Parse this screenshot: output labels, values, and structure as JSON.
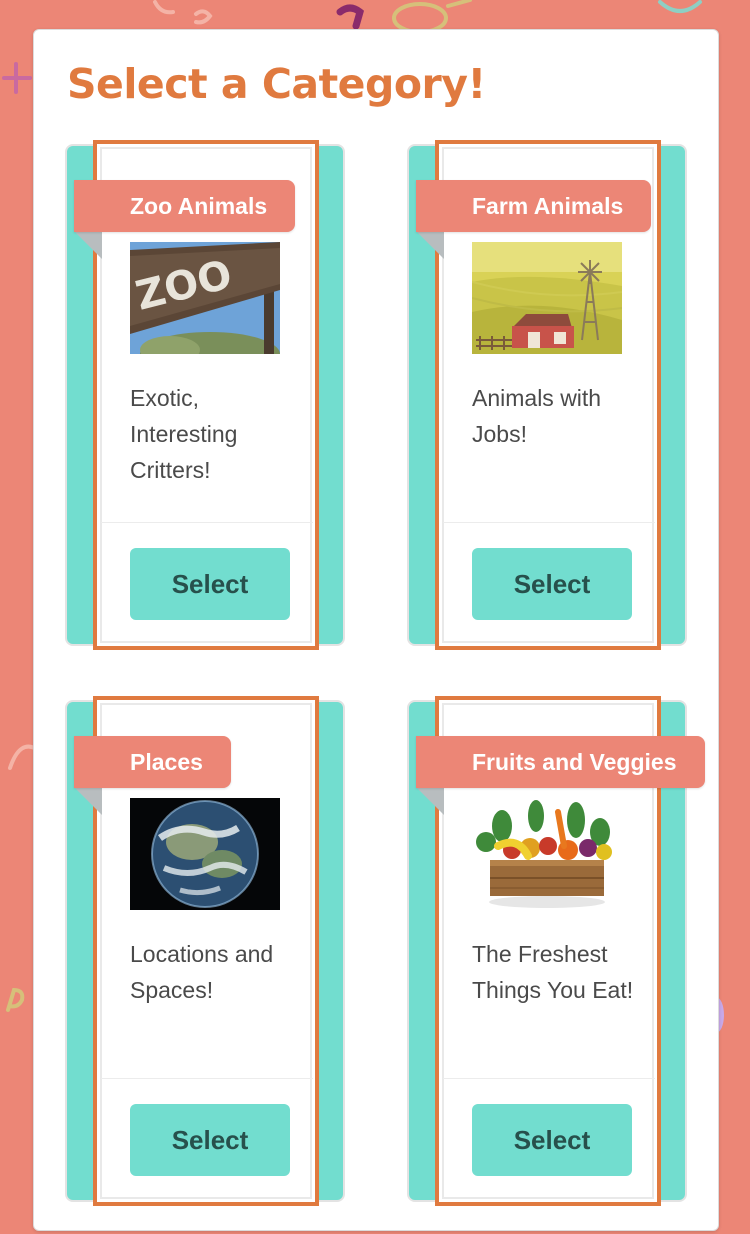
{
  "page": {
    "title": "Select a Category!",
    "colors": {
      "background": "#ec8676",
      "accent_orange": "#e07a3f",
      "teal": "#72ddcf",
      "button_text": "#27504c"
    }
  },
  "categories": [
    {
      "name": "Zoo Animals",
      "description": "Exotic, Interesting Critters!",
      "image": "zoo-sign-image",
      "button_label": "Select"
    },
    {
      "name": "Farm Animals",
      "description": "Animals with Jobs!",
      "image": "farm-windmill-image",
      "button_label": "Select"
    },
    {
      "name": "Places",
      "description": "Locations and Spaces!",
      "image": "earth-globe-image",
      "button_label": "Select"
    },
    {
      "name": "Fruits and Veggies",
      "description": "The Freshest Things You Eat!",
      "image": "vegetable-crate-image",
      "button_label": "Select"
    }
  ]
}
